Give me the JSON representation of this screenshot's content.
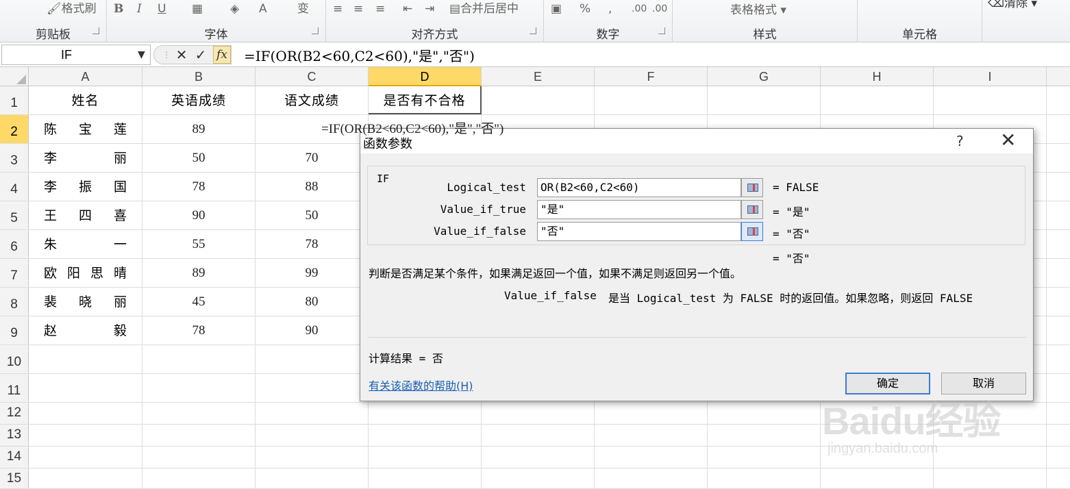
{
  "ribbon": {
    "format_painter": "格式刷",
    "groups": [
      "剪贴板",
      "字体",
      "对齐方式",
      "数字",
      "样式",
      "单元格"
    ],
    "merge_center": "合并后居中",
    "table_format": "表格格式",
    "clear": "清除",
    "percent": "%",
    "comma": ","
  },
  "formula_bar": {
    "name_box": "IF",
    "formula": "=IF(OR(B2<60,C2<60),\"是\",\"否\")",
    "cancel_glyph": "✕",
    "enter_glyph": "✓",
    "fx_glyph": "fx"
  },
  "columns": [
    "A",
    "B",
    "C",
    "D",
    "E",
    "F",
    "G",
    "H",
    "I"
  ],
  "selected_column": "D",
  "selected_row": "2",
  "rows": [
    {
      "num": "1",
      "a": "姓名",
      "b": "英语成绩",
      "c": "语文成绩",
      "d": "是否有不合格"
    },
    {
      "num": "2",
      "a": [
        "陈",
        "宝",
        "莲"
      ],
      "b": "89",
      "c": "=IF(OR(B2<60,C2<60),\"是\",\"否\")",
      "d": ""
    },
    {
      "num": "3",
      "a": [
        "李",
        "丽"
      ],
      "b": "50",
      "c": "70",
      "d": ""
    },
    {
      "num": "4",
      "a": [
        "李",
        "振",
        "国"
      ],
      "b": "78",
      "c": "88",
      "d": ""
    },
    {
      "num": "5",
      "a": [
        "王",
        "四",
        "喜"
      ],
      "b": "90",
      "c": "50",
      "d": ""
    },
    {
      "num": "6",
      "a": [
        "朱",
        "一"
      ],
      "b": "55",
      "c": "78",
      "d": ""
    },
    {
      "num": "7",
      "a": [
        "欧",
        "阳",
        "思",
        "晴"
      ],
      "b": "89",
      "c": "99",
      "d": ""
    },
    {
      "num": "8",
      "a": [
        "裴",
        "晓",
        "丽"
      ],
      "b": "45",
      "c": "80",
      "d": ""
    },
    {
      "num": "9",
      "a": [
        "赵",
        "毅"
      ],
      "b": "78",
      "c": "90",
      "d": ""
    },
    {
      "num": "10"
    },
    {
      "num": "11"
    },
    {
      "num": "12"
    },
    {
      "num": "13"
    },
    {
      "num": "14"
    },
    {
      "num": "15"
    }
  ],
  "dialog": {
    "title": "函数参数",
    "help_glyph": "?",
    "close_glyph": "✕",
    "function_name": "IF",
    "params": [
      {
        "label": "Logical_test",
        "value": "OR(B2<60,C2<60)",
        "result": "=  FALSE"
      },
      {
        "label": "Value_if_true",
        "value": "\"是\"",
        "result": "=  \"是\""
      },
      {
        "label": "Value_if_false",
        "value": "\"否\"",
        "result": "=  \"否\""
      }
    ],
    "final_result": "=  \"否\"",
    "description": "判断是否满足某个条件，如果满足返回一个值，如果不满足则返回另一个值。",
    "param_desc_name": "Value_if_false",
    "param_desc": "是当 Logical_test 为 FALSE 时的返回值。如果忽略，则返回 FALSE",
    "calc_result": "计算结果 =  否",
    "help_link": "有关该函数的帮助(H)",
    "ok": "确定",
    "cancel": "取消"
  },
  "watermark": {
    "logo": "Baidu经验",
    "url": "jingyan.baidu.com"
  }
}
